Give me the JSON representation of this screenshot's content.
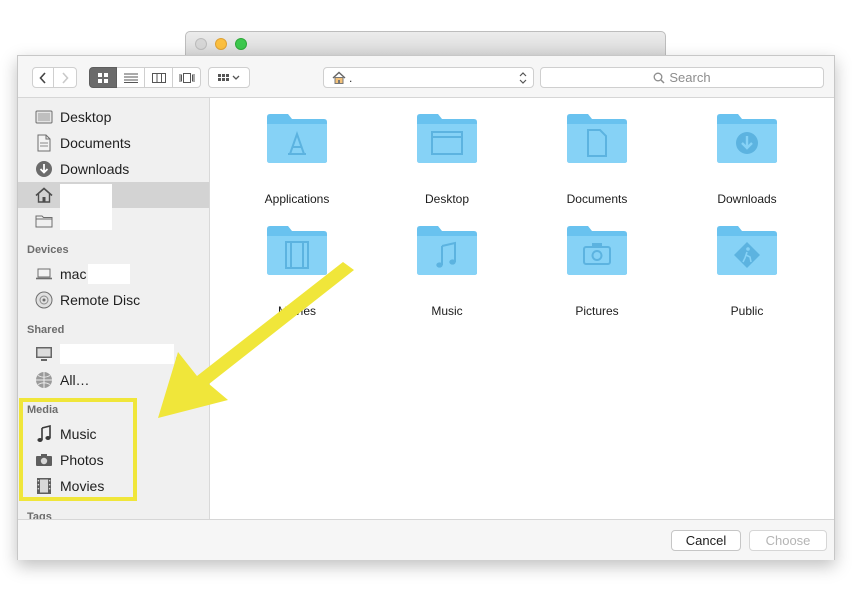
{
  "toolbar": {
    "path_label": ".",
    "search_placeholder": "Search"
  },
  "sidebar": {
    "favorites": [
      {
        "label": "Desktop",
        "icon": "desktop-icon"
      },
      {
        "label": "Documents",
        "icon": "documents-icon"
      },
      {
        "label": "Downloads",
        "icon": "downloads-icon"
      },
      {
        "label": "",
        "icon": "home-icon",
        "selected": true
      },
      {
        "label": "",
        "icon": "folder-icon"
      }
    ],
    "devices_header": "Devices",
    "devices": [
      {
        "label": "mac",
        "icon": "laptop-icon"
      },
      {
        "label": "Remote Disc",
        "icon": "remote-disc-icon"
      }
    ],
    "shared_header": "Shared",
    "shared": [
      {
        "label": "..",
        "icon": "monitor-icon"
      },
      {
        "label": "All…",
        "icon": "network-icon"
      }
    ],
    "media_header": "Media",
    "media": [
      {
        "label": "Music",
        "icon": "music-note-icon"
      },
      {
        "label": "Photos",
        "icon": "camera-icon"
      },
      {
        "label": "Movies",
        "icon": "film-icon"
      }
    ],
    "tags_header": "Tags"
  },
  "folders": [
    {
      "name": "Applications",
      "icon": "applications-folder-icon"
    },
    {
      "name": "Desktop",
      "icon": "desktop-folder-icon"
    },
    {
      "name": "Documents",
      "icon": "documents-folder-icon"
    },
    {
      "name": "Downloads",
      "icon": "downloads-folder-icon"
    },
    {
      "name": "Movies",
      "icon": "movies-folder-icon"
    },
    {
      "name": "Music",
      "icon": "music-folder-icon"
    },
    {
      "name": "Pictures",
      "icon": "pictures-folder-icon"
    },
    {
      "name": "Public",
      "icon": "public-folder-icon"
    }
  ],
  "buttons": {
    "cancel": "Cancel",
    "choose": "Choose"
  },
  "colors": {
    "folder_blue": "#6ec7f2",
    "annotation_yellow": "#f0e63a"
  }
}
